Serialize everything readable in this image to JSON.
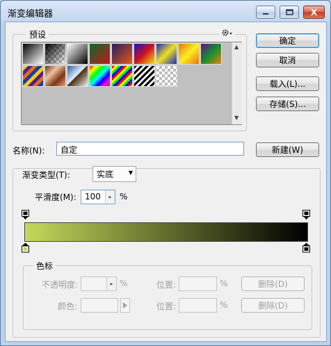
{
  "window": {
    "title": "渐变编辑器"
  },
  "titlebar": {
    "close_glyph": "X"
  },
  "presets": {
    "legend": "预设",
    "gear_icon": "gear-icon",
    "scroll_up": "▲",
    "scroll_down": "▼"
  },
  "buttons": {
    "ok": "确定",
    "cancel": "取消",
    "load": "载入(L)...",
    "save": "存储(S)...",
    "new": "新建(W)"
  },
  "name": {
    "label": "名称(N):",
    "value": "自定"
  },
  "gradient_type": {
    "label": "渐变类型(T):",
    "value": "实底",
    "dropdown_glyph": "▼"
  },
  "smoothness": {
    "label": "平滑度(M):",
    "value": "100",
    "unit": "%",
    "spin_glyph": "▸"
  },
  "gradient": {
    "start_color": "#c5d95b",
    "end_color": "#000000"
  },
  "color_stops": {
    "legend": "色标",
    "opacity_label": "不透明度:",
    "opacity_unit": "%",
    "location_label_1": "位置:",
    "location_unit_1": "%",
    "delete_1": "删除(D)",
    "color_label": "颜色:",
    "location_label_2": "位置:",
    "location_unit_2": "%",
    "delete_2": "删除(D)",
    "spin_glyph": "▸"
  }
}
